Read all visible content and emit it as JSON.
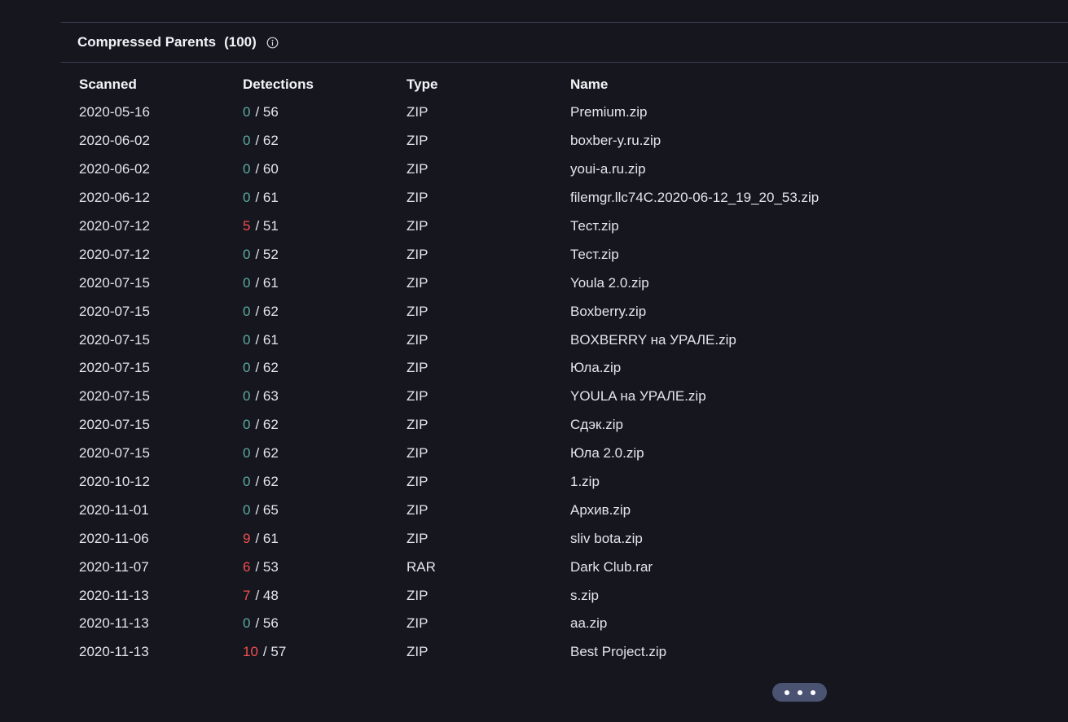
{
  "panel": {
    "title": "Compressed Parents",
    "count": "(100)",
    "info_icon": "info-icon"
  },
  "table": {
    "columns": [
      "Scanned",
      "Detections",
      "Type",
      "Name"
    ],
    "rows": [
      {
        "scanned": "2020-05-16",
        "positives": "0",
        "total": "/ 56",
        "type": "ZIP",
        "name": "Premium.zip"
      },
      {
        "scanned": "2020-06-02",
        "positives": "0",
        "total": "/ 62",
        "type": "ZIP",
        "name": "boxber-y.ru.zip"
      },
      {
        "scanned": "2020-06-02",
        "positives": "0",
        "total": "/ 60",
        "type": "ZIP",
        "name": "youi-a.ru.zip"
      },
      {
        "scanned": "2020-06-12",
        "positives": "0",
        "total": "/ 61",
        "type": "ZIP",
        "name": "filemgr.llc74C.2020-06-12_19_20_53.zip"
      },
      {
        "scanned": "2020-07-12",
        "positives": "5",
        "total": "/ 51",
        "type": "ZIP",
        "name": "Тест.zip"
      },
      {
        "scanned": "2020-07-12",
        "positives": "0",
        "total": "/ 52",
        "type": "ZIP",
        "name": "Тест.zip"
      },
      {
        "scanned": "2020-07-15",
        "positives": "0",
        "total": "/ 61",
        "type": "ZIP",
        "name": "Youla 2.0.zip"
      },
      {
        "scanned": "2020-07-15",
        "positives": "0",
        "total": "/ 62",
        "type": "ZIP",
        "name": "Boxberry.zip"
      },
      {
        "scanned": "2020-07-15",
        "positives": "0",
        "total": "/ 61",
        "type": "ZIP",
        "name": "BOXBERRY на УРАЛЕ.zip"
      },
      {
        "scanned": "2020-07-15",
        "positives": "0",
        "total": "/ 62",
        "type": "ZIP",
        "name": "Юла.zip"
      },
      {
        "scanned": "2020-07-15",
        "positives": "0",
        "total": "/ 63",
        "type": "ZIP",
        "name": "YOULA на УРАЛЕ.zip"
      },
      {
        "scanned": "2020-07-15",
        "positives": "0",
        "total": "/ 62",
        "type": "ZIP",
        "name": "Сдэк.zip"
      },
      {
        "scanned": "2020-07-15",
        "positives": "0",
        "total": "/ 62",
        "type": "ZIP",
        "name": "Юла 2.0.zip"
      },
      {
        "scanned": "2020-10-12",
        "positives": "0",
        "total": "/ 62",
        "type": "ZIP",
        "name": "1.zip"
      },
      {
        "scanned": "2020-11-01",
        "positives": "0",
        "total": "/ 65",
        "type": "ZIP",
        "name": "Архив.zip"
      },
      {
        "scanned": "2020-11-06",
        "positives": "9",
        "total": "/ 61",
        "type": "ZIP",
        "name": "sliv bota.zip"
      },
      {
        "scanned": "2020-11-07",
        "positives": "6",
        "total": "/ 53",
        "type": "RAR",
        "name": "Dark Club.rar"
      },
      {
        "scanned": "2020-11-13",
        "positives": "7",
        "total": "/ 48",
        "type": "ZIP",
        "name": "s.zip"
      },
      {
        "scanned": "2020-11-13",
        "positives": "0",
        "total": "/ 56",
        "type": "ZIP",
        "name": "aa.zip"
      },
      {
        "scanned": "2020-11-13",
        "positives": "10",
        "total": "/ 57",
        "type": "ZIP",
        "name": "Best Project.zip"
      }
    ]
  },
  "more_button": {
    "icon": "more-dots-icon"
  },
  "colors": {
    "background": "#16161f",
    "clean": "#5cab9a",
    "malicious": "#f0504f",
    "button": "#4a5472"
  }
}
